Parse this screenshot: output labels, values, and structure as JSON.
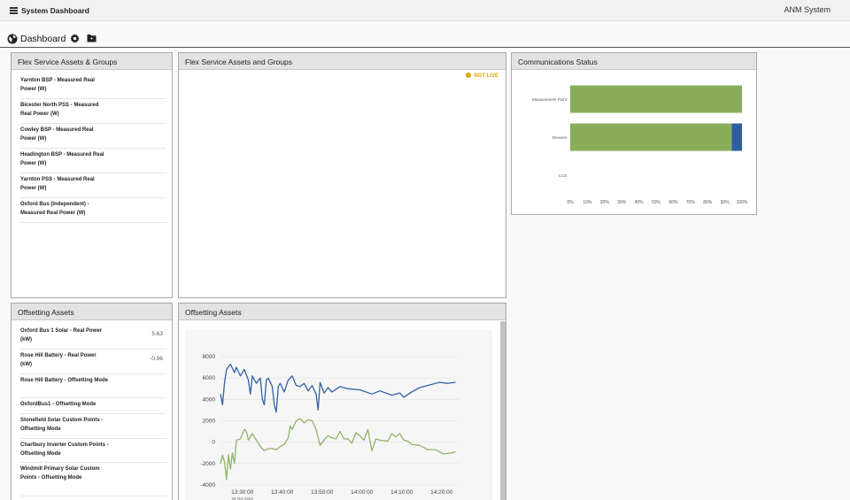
{
  "header": {
    "app_title": "System Dashboard",
    "system_name": "ANM System"
  },
  "subheader": {
    "page_title": "Dashboard"
  },
  "icons": {
    "menu": "hamburger-icon",
    "globe": "globe-icon",
    "settings": "gear-icon",
    "folder": "folder-icon",
    "status_dot": "dot-icon"
  },
  "colors": {
    "accent_green": "#8aad5a",
    "accent_blue": "#2f5f9e",
    "line_blue": "#3561a6",
    "line_green": "#90b56a",
    "not_live": "#e0a800"
  },
  "flex_panel": {
    "title": "Flex Service Assets & Groups",
    "items": [
      "Yarnton BSP - Measured Real Power (W)",
      "Bicester North PSS - Measured Real Power (W)",
      "Cowley BSP - Measured Real Power (W)",
      "Headington BSP - Measured Real Power (W)",
      "Yarnton PSS - Measured Real Power (W)",
      "Oxford Bus (Independent) - Measured Real Power (W)"
    ]
  },
  "flex_chart_panel": {
    "title": "Flex Service Assets and Groups",
    "status": "NOT LIVE"
  },
  "comms_panel": {
    "title": "Communications Status"
  },
  "offset_panel": {
    "title": "Offsetting Assets",
    "items": [
      {
        "label": "Oxford Bus 1 Solar - Real Power (kW)",
        "value": "5.63"
      },
      {
        "label": "Rose Hill Battery - Real Power (kW)",
        "value": "-0.96"
      },
      {
        "label": "Rose Hill Battery - Offsetting Mode",
        "value": ""
      },
      {
        "label": "OxfordBus1 - Offsetting Mode",
        "value": ""
      },
      {
        "label": "Stonefield Solar Custom Points - Offsetting Mode",
        "value": ""
      },
      {
        "label": "Charlbury Inverter Custom Points - Offsetting Mode",
        "value": ""
      },
      {
        "label": "Windmill Primary Solar Custom Points - Offsetting Mode",
        "value": ""
      }
    ]
  },
  "offset_chart_panel": {
    "title": "Offsetting Assets"
  },
  "chart_data": [
    {
      "type": "bar",
      "orientation": "horizontal",
      "stacked": true,
      "categories": [
        "Measurement Point",
        "Devices",
        "LCS"
      ],
      "series": [
        {
          "values": [
            100,
            94,
            0
          ],
          "color": "#8aad5a"
        },
        {
          "values": [
            0,
            6,
            0
          ],
          "color": "#2f5f9e"
        }
      ],
      "xlim": [
        0,
        100
      ],
      "xticks": [
        "0%",
        "10%",
        "20%",
        "30%",
        "40%",
        "50%",
        "60%",
        "70%",
        "80%",
        "90%",
        "100%"
      ],
      "grid": false,
      "legend": "none"
    },
    {
      "type": "line",
      "x_ticks": [
        "13:30:00",
        "13:40:00",
        "13:50:00",
        "14:00:00",
        "14:10:00",
        "14:20:00"
      ],
      "x_sublabel": "25 Oct 2022",
      "x_range_minutes": [
        0,
        60
      ],
      "x_tick_minutes": [
        5.5,
        15.5,
        25.5,
        35.5,
        45.5,
        55.5
      ],
      "ylim": [
        -4000,
        8000
      ],
      "yticks": [
        -4000,
        -2000,
        0,
        2000,
        4000,
        6000,
        8000
      ],
      "grid": true,
      "legend": "none",
      "series": [
        {
          "color": "#3561a6",
          "points": [
            [
              0,
              4500
            ],
            [
              0.5,
              3500
            ],
            [
              1,
              5500
            ],
            [
              1.5,
              6800
            ],
            [
              2.5,
              7300
            ],
            [
              3.5,
              6500
            ],
            [
              4,
              7000
            ],
            [
              5,
              6200
            ],
            [
              6,
              6800
            ],
            [
              7,
              5800
            ],
            [
              7.5,
              4500
            ],
            [
              8,
              6200
            ],
            [
              9,
              5500
            ],
            [
              10,
              6000
            ],
            [
              10.5,
              4000
            ],
            [
              11,
              3500
            ],
            [
              11.5,
              5800
            ],
            [
              12,
              6000
            ],
            [
              13,
              5200
            ],
            [
              13.5,
              3500
            ],
            [
              14,
              2800
            ],
            [
              14.5,
              5200
            ],
            [
              15,
              5500
            ],
            [
              16,
              4700
            ],
            [
              17,
              5800
            ],
            [
              18,
              6200
            ],
            [
              19,
              5300
            ],
            [
              20,
              5200
            ],
            [
              21,
              5500
            ],
            [
              22,
              4800
            ],
            [
              23,
              5300
            ],
            [
              24,
              4500
            ],
            [
              24.5,
              3000
            ],
            [
              25,
              5600
            ],
            [
              26,
              4600
            ],
            [
              27,
              5100
            ],
            [
              28,
              4700
            ],
            [
              30,
              5200
            ],
            [
              32,
              5000
            ],
            [
              35,
              4900
            ],
            [
              38,
              4500
            ],
            [
              40,
              4800
            ],
            [
              43,
              4400
            ],
            [
              45,
              4600
            ],
            [
              46,
              4200
            ],
            [
              48,
              4700
            ],
            [
              50,
              5100
            ],
            [
              52,
              5300
            ],
            [
              55,
              5600
            ],
            [
              57,
              5500
            ],
            [
              59,
              5600
            ]
          ]
        },
        {
          "color": "#90b56a",
          "points": [
            [
              0,
              -2000
            ],
            [
              0.5,
              -1200
            ],
            [
              1,
              -1800
            ],
            [
              1.5,
              -3500
            ],
            [
              2,
              -1200
            ],
            [
              2.5,
              -2500
            ],
            [
              3,
              -1000
            ],
            [
              3.5,
              -2000
            ],
            [
              4,
              200
            ],
            [
              5,
              300
            ],
            [
              6,
              1200
            ],
            [
              6.5,
              1000
            ],
            [
              7,
              200
            ],
            [
              8,
              800
            ],
            [
              9,
              200
            ],
            [
              10,
              -400
            ],
            [
              11,
              -800
            ],
            [
              12,
              -600
            ],
            [
              13,
              -600
            ],
            [
              14,
              -700
            ],
            [
              15,
              -400
            ],
            [
              16,
              -200
            ],
            [
              17,
              400
            ],
            [
              17.5,
              1500
            ],
            [
              18,
              1200
            ],
            [
              19,
              2000
            ],
            [
              20,
              2200
            ],
            [
              21,
              1800
            ],
            [
              22,
              2100
            ],
            [
              23,
              2000
            ],
            [
              24,
              1200
            ],
            [
              25,
              -300
            ],
            [
              26,
              200
            ],
            [
              27,
              600
            ],
            [
              28,
              400
            ],
            [
              29,
              300
            ],
            [
              30,
              1000
            ],
            [
              31,
              300
            ],
            [
              32,
              300
            ],
            [
              33,
              -100
            ],
            [
              34,
              900
            ],
            [
              35,
              600
            ],
            [
              36,
              200
            ],
            [
              37,
              1200
            ],
            [
              38,
              -800
            ],
            [
              39,
              300
            ],
            [
              40,
              200
            ],
            [
              42,
              100
            ],
            [
              43,
              800
            ],
            [
              44,
              500
            ],
            [
              45,
              800
            ],
            [
              46,
              200
            ],
            [
              47,
              100
            ],
            [
              48,
              -200
            ],
            [
              50,
              -300
            ],
            [
              52,
              -700
            ],
            [
              54,
              -700
            ],
            [
              56,
              -1100
            ],
            [
              58,
              -1000
            ],
            [
              59,
              -900
            ]
          ]
        }
      ]
    }
  ]
}
